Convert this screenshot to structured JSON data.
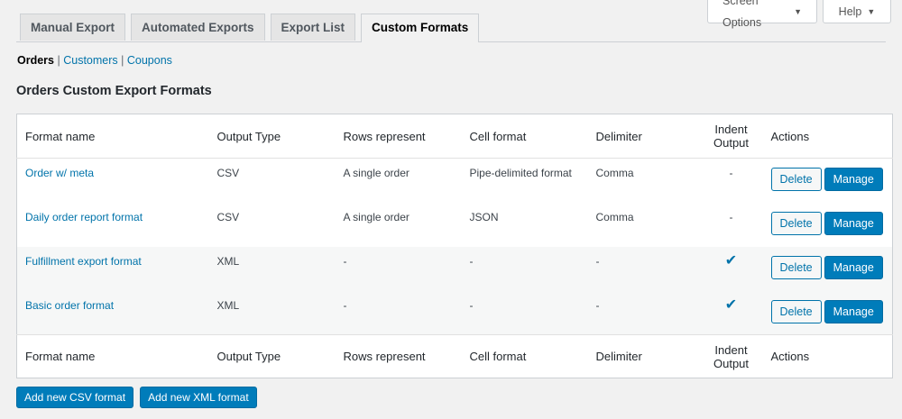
{
  "screen_meta": {
    "screen_options_label": "Screen Options",
    "help_label": "Help"
  },
  "tabs": [
    {
      "label": "Manual Export"
    },
    {
      "label": "Automated Exports"
    },
    {
      "label": "Export List"
    },
    {
      "label": "Custom Formats"
    }
  ],
  "subsub": {
    "orders": "Orders",
    "customers": "Customers",
    "coupons": "Coupons"
  },
  "section_title": "Orders Custom Export Formats",
  "table": {
    "headers": {
      "format_name": "Format name",
      "output_type": "Output Type",
      "rows_represent": "Rows represent",
      "cell_format": "Cell format",
      "delimiter": "Delimiter",
      "indent_line1": "Indent",
      "indent_line2": "Output",
      "actions": "Actions"
    },
    "rows": [
      {
        "name": "Order w/ meta",
        "output_type": "CSV",
        "rows_represent": "A single order",
        "cell_format": "Pipe-delimited format",
        "delimiter": "Comma",
        "indent": "-",
        "delete": "Delete",
        "manage": "Manage"
      },
      {
        "name": "Daily order report format",
        "output_type": "CSV",
        "rows_represent": "A single order",
        "cell_format": "JSON",
        "delimiter": "Comma",
        "indent": "-",
        "delete": "Delete",
        "manage": "Manage"
      },
      {
        "name": "Fulfillment export format",
        "output_type": "XML",
        "rows_represent": "-",
        "cell_format": "-",
        "delimiter": "-",
        "indent": "✔",
        "delete": "Delete",
        "manage": "Manage"
      },
      {
        "name": "Basic order format",
        "output_type": "XML",
        "rows_represent": "-",
        "cell_format": "-",
        "delimiter": "-",
        "indent": "✔",
        "delete": "Delete",
        "manage": "Manage"
      }
    ]
  },
  "buttons": {
    "add_csv": "Add new CSV format",
    "add_xml": "Add new XML format"
  },
  "colors": {
    "link": "#0073aa",
    "primary_button": "#007cba",
    "background": "#f1f1f1"
  }
}
